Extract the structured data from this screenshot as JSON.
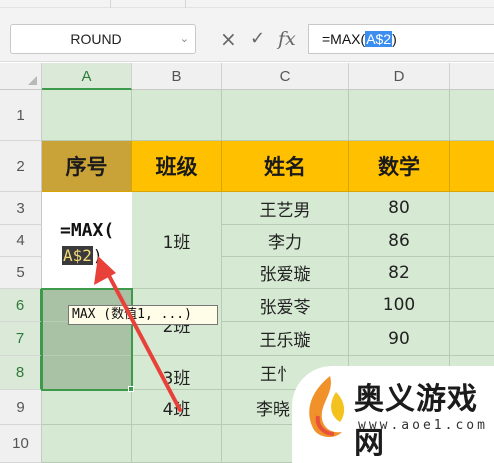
{
  "toolbar": {
    "name_box": "ROUND",
    "cancel_symbol": "×",
    "confirm_symbol": "✓",
    "fx_symbol": "fx",
    "formula_prefix": "=MAX(",
    "formula_ref": "A$2",
    "formula_suffix": ")"
  },
  "columns": [
    "A",
    "B",
    "C",
    "D"
  ],
  "rows": [
    "1",
    "2",
    "3",
    "4",
    "5",
    "6",
    "7",
    "8",
    "9",
    "10"
  ],
  "sheet": {
    "headers": {
      "a": "序号",
      "b": "班级",
      "c": "姓名",
      "d": "数学"
    },
    "class_1": "1班",
    "class_2": "2班",
    "class_3": "3班",
    "class_4": "4班",
    "names": [
      "王艺男",
      "李力",
      "张爱璇",
      "张爱苓",
      "王乐璇",
      "王忄",
      "李晓"
    ],
    "scores": [
      "80",
      "86",
      "82",
      "100",
      "90"
    ]
  },
  "editor": {
    "line1": "=MAX(",
    "ref": "A$2",
    "close": ")"
  },
  "tooltip": "MAX (数值1, ...)",
  "watermark": {
    "name": "奥义游戏网",
    "url": "www.aoe1.com"
  },
  "colors": {
    "header_fill": "#ffc000",
    "cell_fill": "#d6ead3",
    "selection": "#3c9a4a",
    "arrow": "#e8413a"
  }
}
